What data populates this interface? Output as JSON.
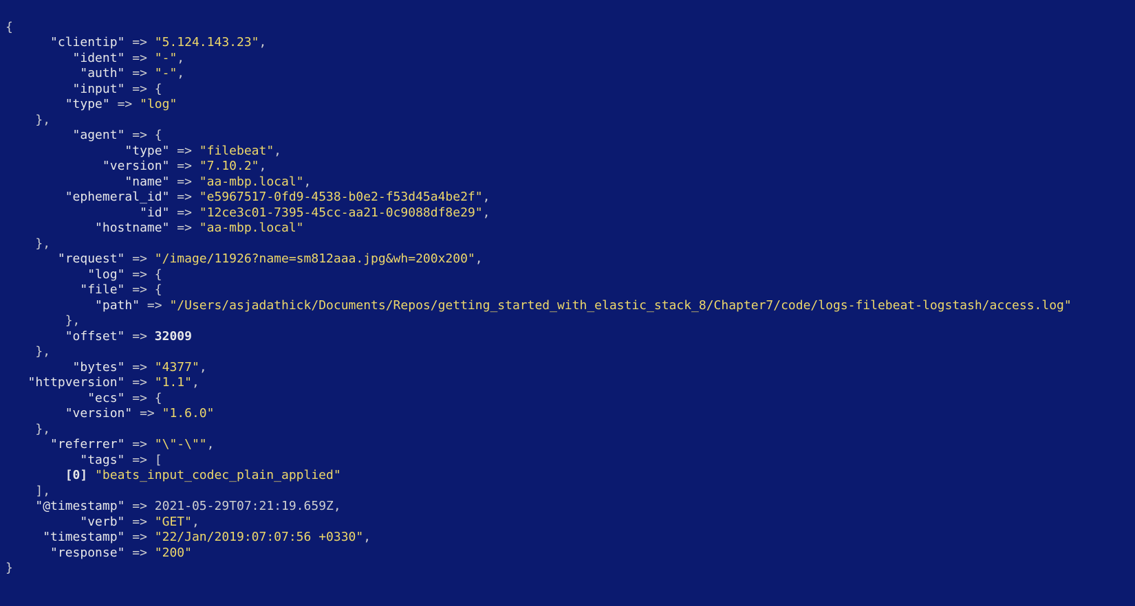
{
  "glyphs": {
    "open_brace": "{",
    "close_brace": "}",
    "arrow": "=>",
    "comma": ",",
    "open_bracket": "[",
    "close_bracket": "]"
  },
  "keys": {
    "clientip": "\"clientip\"",
    "ident": "\"ident\"",
    "auth": "\"auth\"",
    "input": "\"input\"",
    "type": "\"type\"",
    "agent": "\"agent\"",
    "version": "\"version\"",
    "name": "\"name\"",
    "ephemeral_id": "\"ephemeral_id\"",
    "id": "\"id\"",
    "hostname": "\"hostname\"",
    "request": "\"request\"",
    "log": "\"log\"",
    "file": "\"file\"",
    "path": "\"path\"",
    "offset": "\"offset\"",
    "bytes": "\"bytes\"",
    "httpversion": "\"httpversion\"",
    "ecs": "\"ecs\"",
    "referrer": "\"referrer\"",
    "tags": "\"tags\"",
    "tags_index": "[0]",
    "at_timestamp": "\"@timestamp\"",
    "verb": "\"verb\"",
    "timestamp": "\"timestamp\"",
    "response": "\"response\""
  },
  "values": {
    "clientip": "\"5.124.143.23\"",
    "ident": "\"-\"",
    "auth": "\"-\"",
    "input_type": "\"log\"",
    "agent_type": "\"filebeat\"",
    "agent_version": "\"7.10.2\"",
    "agent_name": "\"aa-mbp.local\"",
    "agent_ephemeral_id": "\"e5967517-0fd9-4538-b0e2-f53d45a4be2f\"",
    "agent_id": "\"12ce3c01-7395-45cc-aa21-0c9088df8e29\"",
    "agent_hostname": "\"aa-mbp.local\"",
    "request": "\"/image/11926?name=sm812aaa.jpg&wh=200x200\"",
    "log_file_path": "\"/Users/asjadathick/Documents/Repos/getting_started_with_elastic_stack_8/Chapter7/code/logs-filebeat-logstash/access.log\"",
    "log_offset": "32009",
    "bytes": "\"4377\"",
    "httpversion": "\"1.1\"",
    "ecs_version": "\"1.6.0\"",
    "referrer": "\"\\\"-\\\"\"",
    "tags_0": "\"beats_input_codec_plain_applied\"",
    "at_timestamp": "2021-05-29T07:21:19.659Z",
    "verb": "\"GET\"",
    "timestamp": "\"22/Jan/2019:07:07:56 +0330\"",
    "response": "\"200\""
  }
}
